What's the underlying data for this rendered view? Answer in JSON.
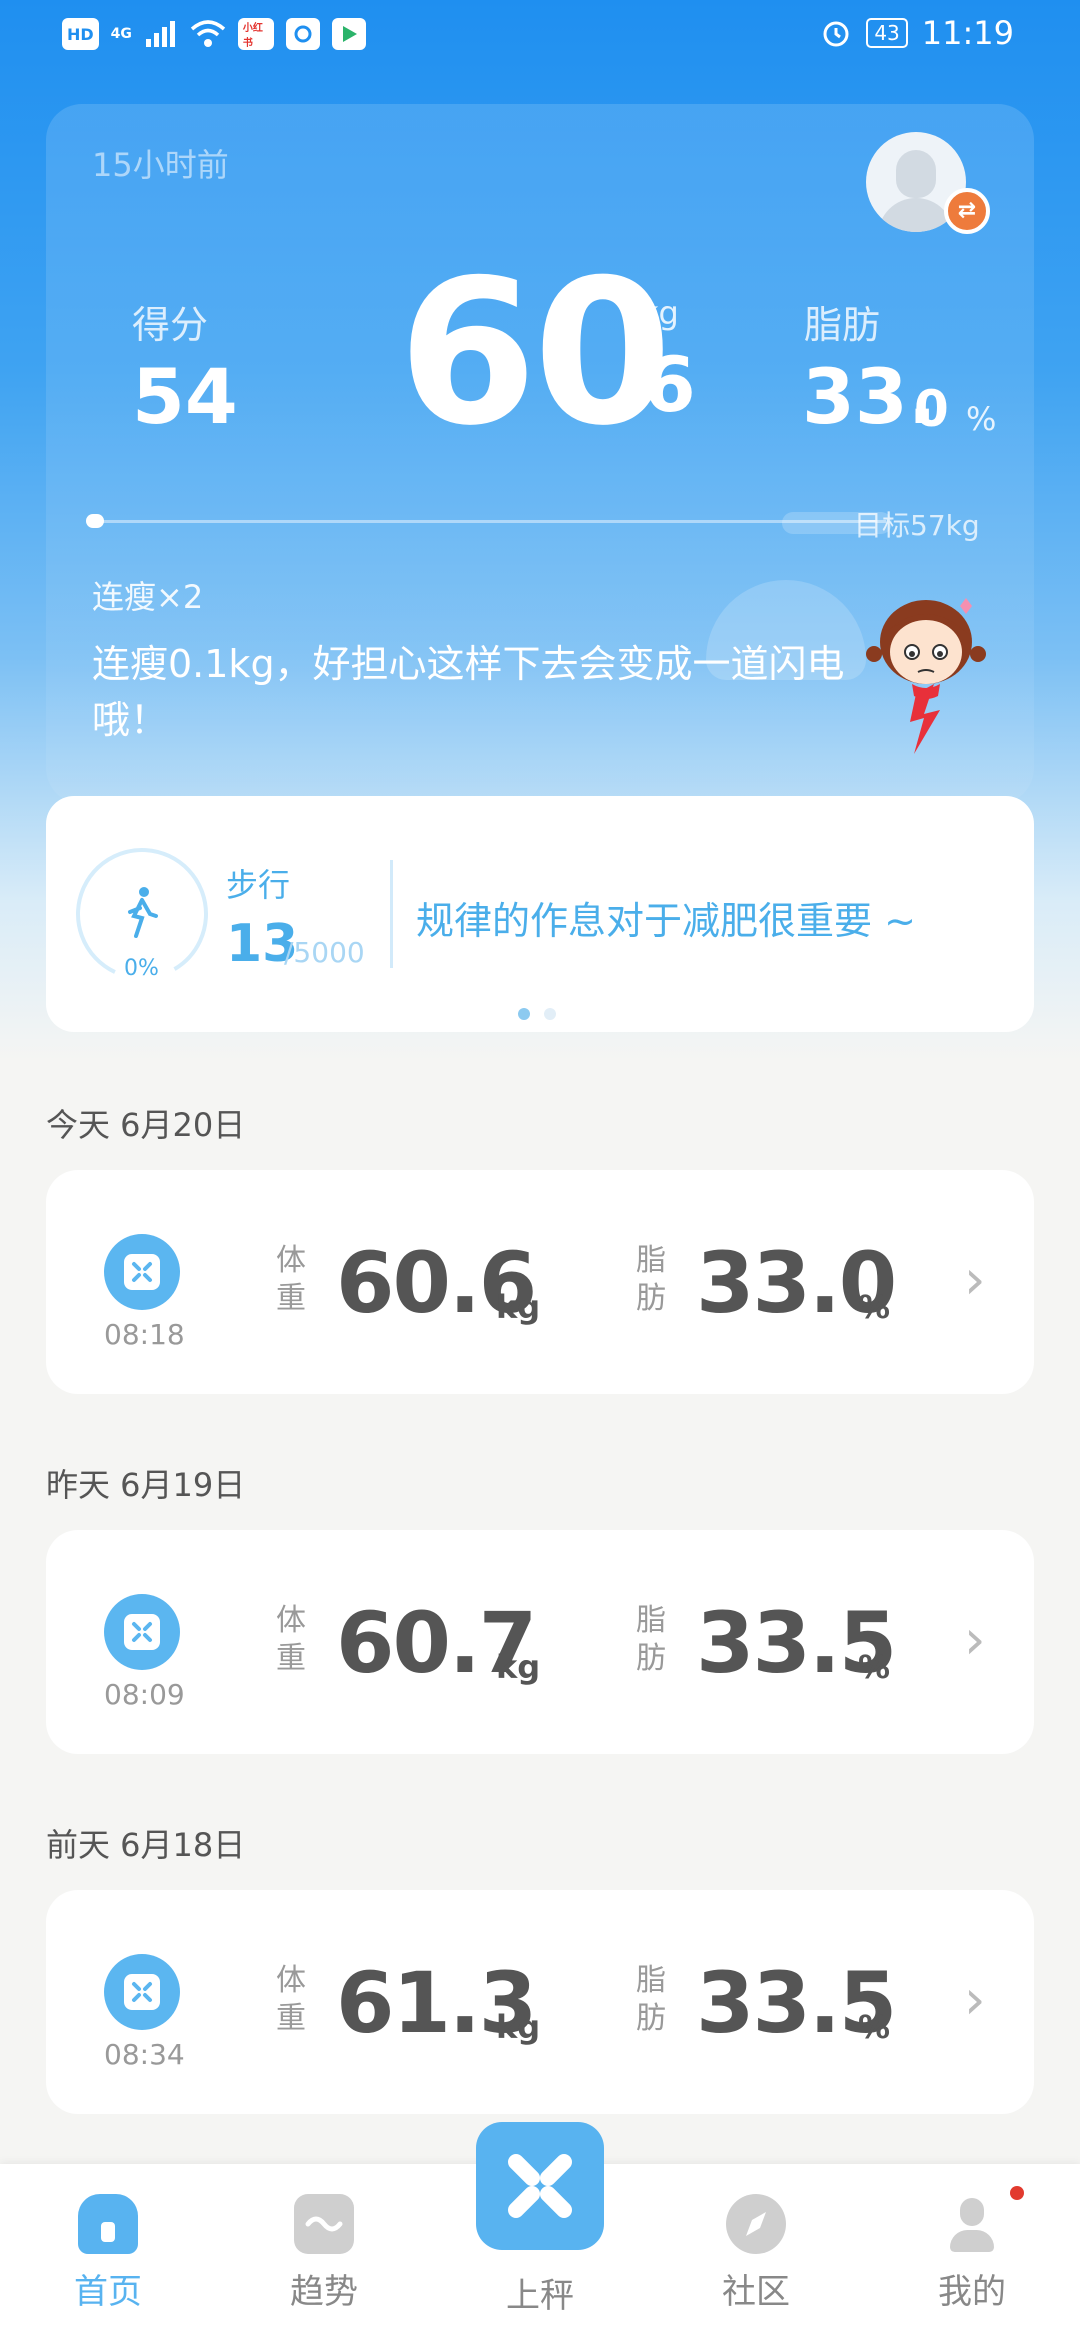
{
  "status_bar": {
    "hd": "HD",
    "network": "4G",
    "app1": "小红书",
    "battery": "43",
    "time": "11:19"
  },
  "hero": {
    "time_ago": "15小时前",
    "score_label": "得分",
    "score_value": "54",
    "weight_int": "60",
    "weight_dec": ".6",
    "weight_unit": "kg",
    "fat_label": "脂肪",
    "fat_int": "33.",
    "fat_dec": "0",
    "fat_unit": "%",
    "goal_text": "目标57kg",
    "goal_progress": 0.01,
    "streak": "连瘦×2",
    "message": "连瘦0.1kg，好担心这样下去会变成一道闪电哦！"
  },
  "steps": {
    "label": "步行",
    "value": "13",
    "goal": "/5000",
    "percent": "0%",
    "tip": "规律的作息对于减肥很重要 ~",
    "pages": 2,
    "active_page": 0
  },
  "records": [
    {
      "day": "今天 6月20日",
      "time": "08:18",
      "weight_label_1": "体",
      "weight_label_2": "重",
      "weight": "60.6",
      "weight_unit": "kg",
      "fat_label_1": "脂",
      "fat_label_2": "肪",
      "fat": "33.0",
      "fat_unit": "%"
    },
    {
      "day": "昨天 6月19日",
      "time": "08:09",
      "weight_label_1": "体",
      "weight_label_2": "重",
      "weight": "60.7",
      "weight_unit": "kg",
      "fat_label_1": "脂",
      "fat_label_2": "肪",
      "fat": "33.5",
      "fat_unit": "%"
    },
    {
      "day": "前天 6月18日",
      "time": "08:34",
      "weight_label_1": "体",
      "weight_label_2": "重",
      "weight": "61.3",
      "weight_unit": "kg",
      "fat_label_1": "脂",
      "fat_label_2": "肪",
      "fat": "33.5",
      "fat_unit": "%"
    }
  ],
  "nav": {
    "home": "首页",
    "trend": "趋势",
    "weigh": "上秤",
    "community": "社区",
    "mine": "我的"
  },
  "colors": {
    "accent": "#58b3f0",
    "hero_top": "#1f8ff0",
    "badge": "#ee7b3c",
    "notify": "#e23a2e"
  }
}
